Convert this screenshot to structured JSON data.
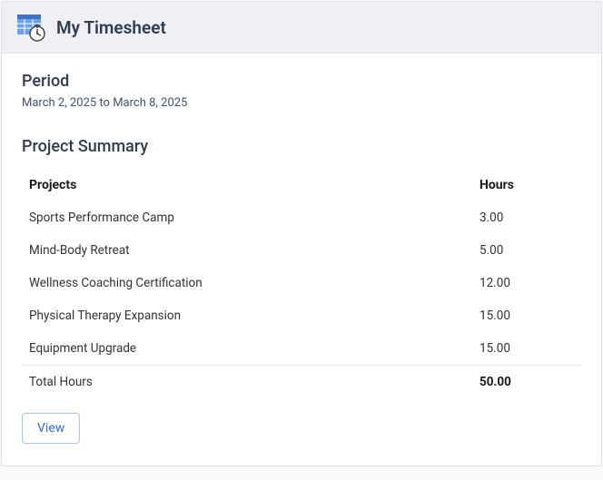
{
  "header": {
    "title": "My Timesheet"
  },
  "period": {
    "heading": "Period",
    "text": "March 2, 2025 to March 8, 2025"
  },
  "summary": {
    "heading": "Project Summary",
    "columns": {
      "projects": "Projects",
      "hours": "Hours"
    },
    "rows": [
      {
        "project": "Sports Performance Camp",
        "hours": "3.00"
      },
      {
        "project": "Mind-Body Retreat",
        "hours": "5.00"
      },
      {
        "project": "Wellness Coaching Certification",
        "hours": "12.00"
      },
      {
        "project": "Physical Therapy Expansion",
        "hours": "15.00"
      },
      {
        "project": "Equipment Upgrade",
        "hours": "15.00"
      }
    ],
    "total": {
      "label": "Total Hours",
      "value": "50.00"
    }
  },
  "actions": {
    "view_label": "View"
  }
}
